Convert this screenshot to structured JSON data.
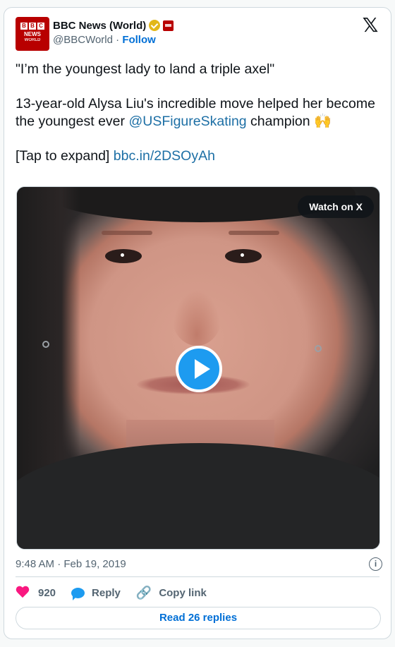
{
  "header": {
    "display_name": "BBC News (World)",
    "handle": "@BBCWorld",
    "separator": "·",
    "follow_label": "Follow",
    "avatar": {
      "blocks": [
        "B",
        "B",
        "C"
      ],
      "line1": "NEWS",
      "line2": "WORLD"
    }
  },
  "tweet": {
    "line1": "\"I’m the youngest lady to land a triple axel\"",
    "line2_a": "13-year-old Alysa Liu's incredible move helped her become the youngest ever ",
    "mention": "@USFigureSkating",
    "line2_b": " champion ",
    "emoji": "🙌",
    "expand_text": "[Tap to expand] ",
    "link": "bbc.in/2DSOyAh"
  },
  "media": {
    "watch_label": "Watch on X"
  },
  "meta": {
    "timestamp": "9:48 AM · Feb 19, 2019",
    "info_glyph": "i"
  },
  "actions": {
    "likes": "920",
    "reply_label": "Reply",
    "copy_link_label": "Copy link"
  },
  "footer": {
    "read_replies_label": "Read 26 replies"
  },
  "colors": {
    "brand_red": "#b80000",
    "accent_blue": "#1d9bf0",
    "link_blue": "#1d6fa5",
    "like_pink": "#f91880"
  }
}
